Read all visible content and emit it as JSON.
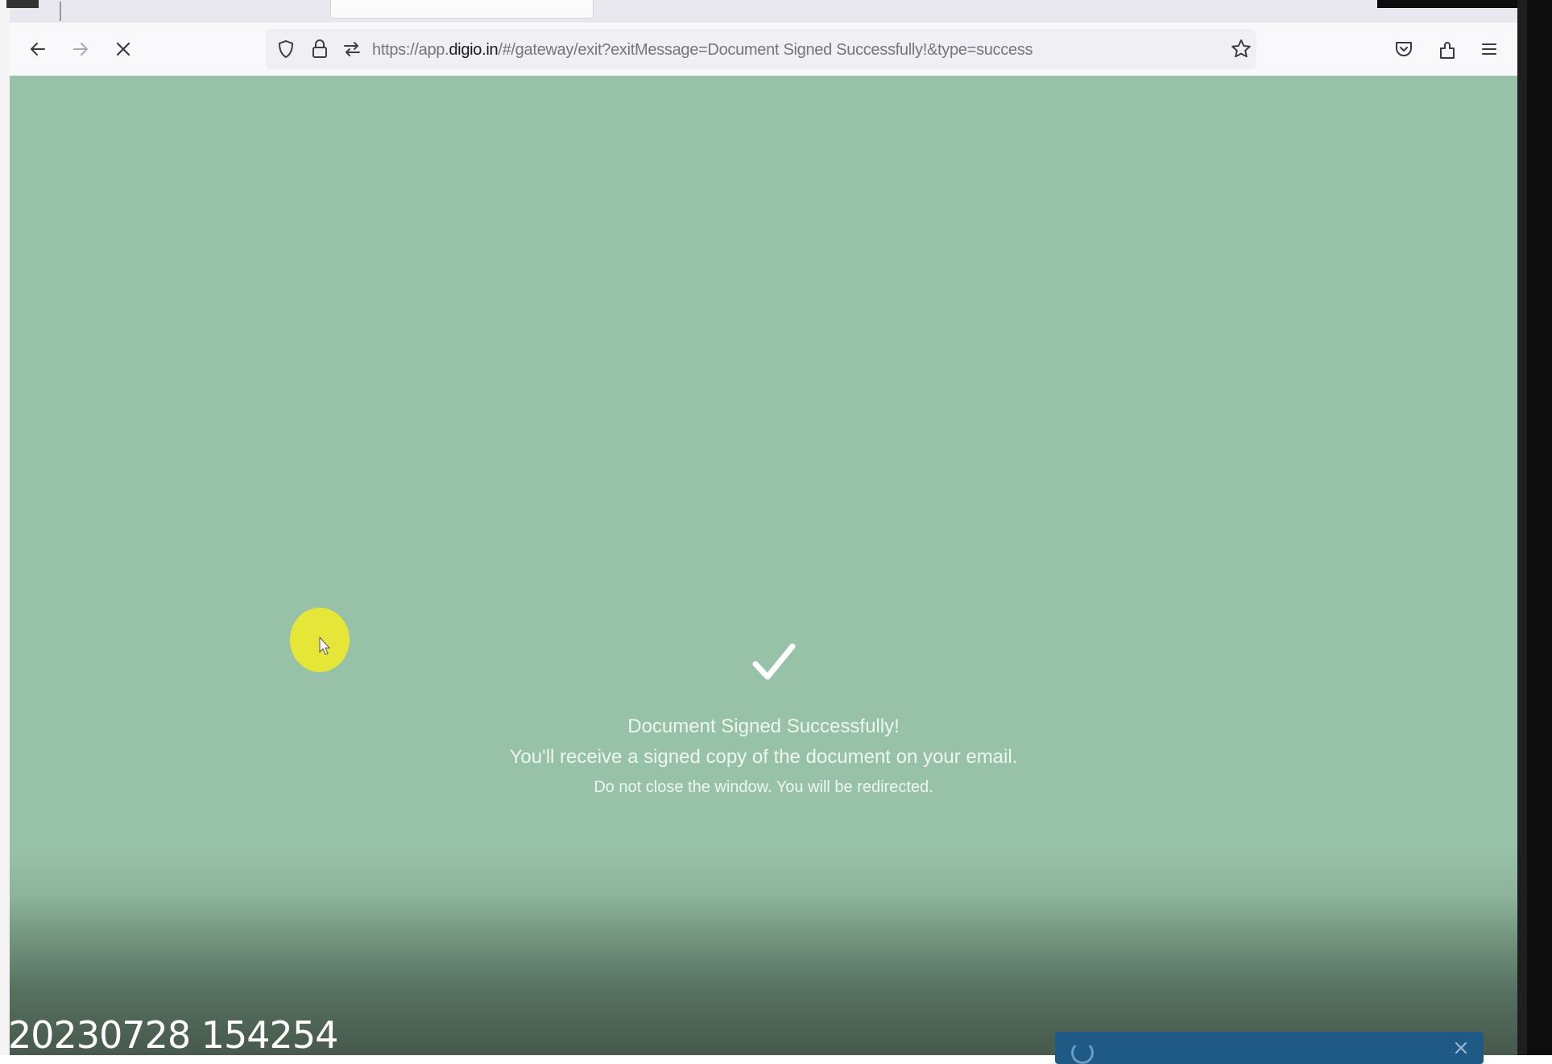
{
  "browser": {
    "url": {
      "prefix": "https://app.",
      "host": "digio.in",
      "suffix": "/#/gateway/exit?exitMessage=Document Signed Successfully!&type=success"
    },
    "icons": {
      "back": "arrow-left-icon",
      "forward": "arrow-right-icon",
      "stop": "close-icon",
      "tracking_protection": "shield-icon",
      "lock": "lock-icon",
      "permissions": "permissions-icon",
      "bookmark": "star-icon",
      "pocket": "pocket-icon",
      "extensions": "extensions-icon",
      "menu": "hamburger-menu-icon"
    }
  },
  "page": {
    "background_color": "#98c2a8",
    "title": "Document Signed Successfully!",
    "email_note": "You'll receive a signed copy of the document on your email.",
    "redirect_note": "Do not close the window. You will be redirected."
  },
  "overlay": {
    "timestamp": "20230728 154254",
    "cursor_highlight_color": "#e5e637"
  }
}
